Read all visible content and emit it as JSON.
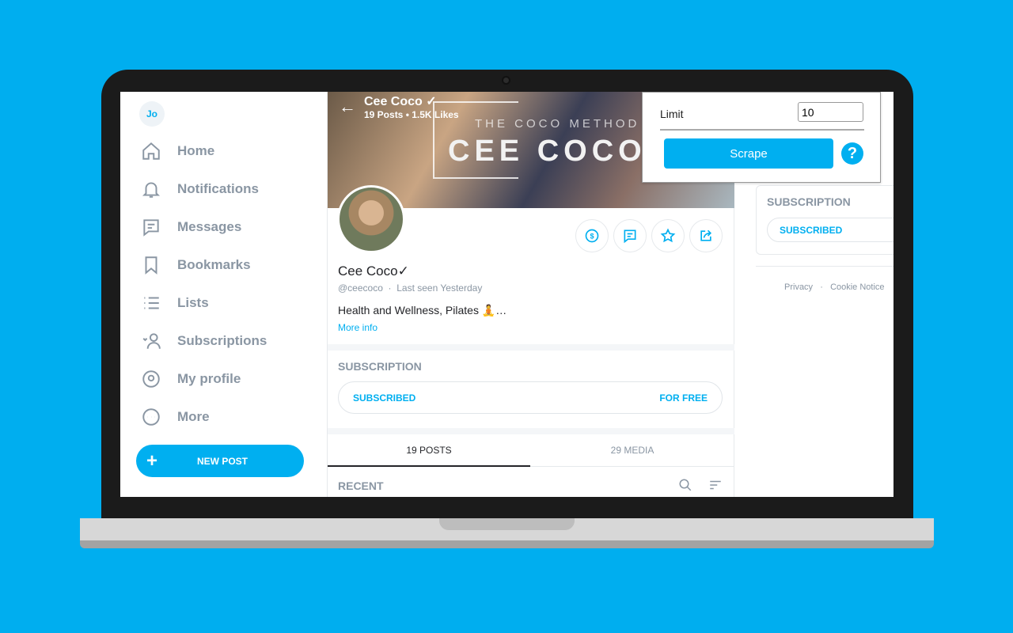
{
  "sidebar": {
    "avatar_initials": "Jo",
    "items": [
      {
        "label": "Home",
        "icon": "home-icon"
      },
      {
        "label": "Notifications",
        "icon": "bell-icon"
      },
      {
        "label": "Messages",
        "icon": "message-icon"
      },
      {
        "label": "Bookmarks",
        "icon": "bookmark-icon"
      },
      {
        "label": "Lists",
        "icon": "list-icon"
      },
      {
        "label": "Subscriptions",
        "icon": "subscriptions-icon"
      },
      {
        "label": "My profile",
        "icon": "profile-icon"
      },
      {
        "label": "More",
        "icon": "more-icon"
      }
    ],
    "new_post": "NEW POST"
  },
  "profile": {
    "header_name": "Cee Coco",
    "posts_count": "19 Posts",
    "likes": "1.5K Likes",
    "cover_subtitle": "THE COCO METHOD",
    "cover_title": "CEE COCO",
    "name": "Cee Coco",
    "handle": "@ceecoco",
    "last_seen": "Last seen Yesterday",
    "bio": "Health and Wellness, Pilates 🧘…",
    "more_info": "More info",
    "subscription_heading": "SUBSCRIPTION",
    "subscribed": "SUBSCRIBED",
    "for_free": "FOR FREE",
    "tabs": [
      "19 POSTS",
      "29 MEDIA"
    ],
    "recent": "RECENT"
  },
  "right": {
    "subscription_heading": "SUBSCRIPTION",
    "subscribed": "SUBSCRIBED",
    "links": [
      "Privacy",
      "Cookie Notice"
    ]
  },
  "popup": {
    "limit_label": "Limit",
    "limit_value": "10",
    "scrape": "Scrape",
    "help": "?"
  },
  "colors": {
    "accent": "#00aff0",
    "background": "#00aeef"
  }
}
